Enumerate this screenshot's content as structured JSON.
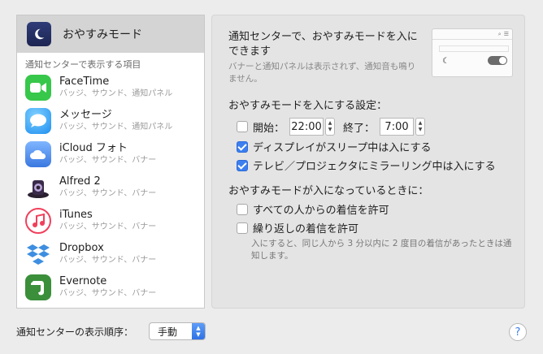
{
  "sidebar": {
    "dnd_label": "おやすみモード",
    "section_header": "通知センターで表示する項目",
    "apps": [
      {
        "name": "FaceTime",
        "detail": "バッジ、サウンド、通知パネル",
        "icon": "facetime-icon",
        "color": "#37c74a"
      },
      {
        "name": "メッセージ",
        "detail": "バッジ、サウンド、通知パネル",
        "icon": "messages-icon",
        "color": "#2ea1f4"
      },
      {
        "name": "iCloud フォト",
        "detail": "バッジ、サウンド、バナー",
        "icon": "icloud-photos-icon",
        "color": "#4a8fe8"
      },
      {
        "name": "Alfred 2",
        "detail": "バッジ、サウンド、バナー",
        "icon": "alfred-icon",
        "color": "#3a2a4a"
      },
      {
        "name": "iTunes",
        "detail": "バッジ、サウンド、バナー",
        "icon": "itunes-icon",
        "color": "#f0405c"
      },
      {
        "name": "Dropbox",
        "detail": "バッジ、サウンド、バナー",
        "icon": "dropbox-icon",
        "color": "#3d8ee0"
      },
      {
        "name": "Evernote",
        "detail": "バッジ、サウンド、バナー",
        "icon": "evernote-icon",
        "color": "#3b8f3a"
      }
    ]
  },
  "panel": {
    "heading": "通知センターで、おやすみモードを入にできます",
    "subtext": "バナーと通知パネルは表示されず、通知音も鳴りません。",
    "schedule_title": "おやすみモードを入にする設定：",
    "start_label": "開始：",
    "start_time": "22:00",
    "end_label": "終了：",
    "end_time": "7:00",
    "start_checked": false,
    "display_sleep_label": "ディスプレイがスリープ中は入にする",
    "display_sleep_checked": true,
    "mirroring_label": "テレビ／プロジェクタにミラーリング中は入にする",
    "mirroring_checked": true,
    "while_on_title": "おやすみモードが入になっているときに：",
    "allow_all_label": "すべての人からの着信を許可",
    "allow_all_checked": false,
    "repeat_label": "繰り返しの着信を許可",
    "repeat_checked": false,
    "repeat_note": "入にすると、同じ人から 3 分以内に 2 度目の着信があったときは通知します。"
  },
  "footer": {
    "order_label": "通知センターの表示順序：",
    "order_value": "手動",
    "help_glyph": "?"
  },
  "colors": {
    "accent": "#3b7ff0",
    "selection": "#d4d4d4"
  }
}
